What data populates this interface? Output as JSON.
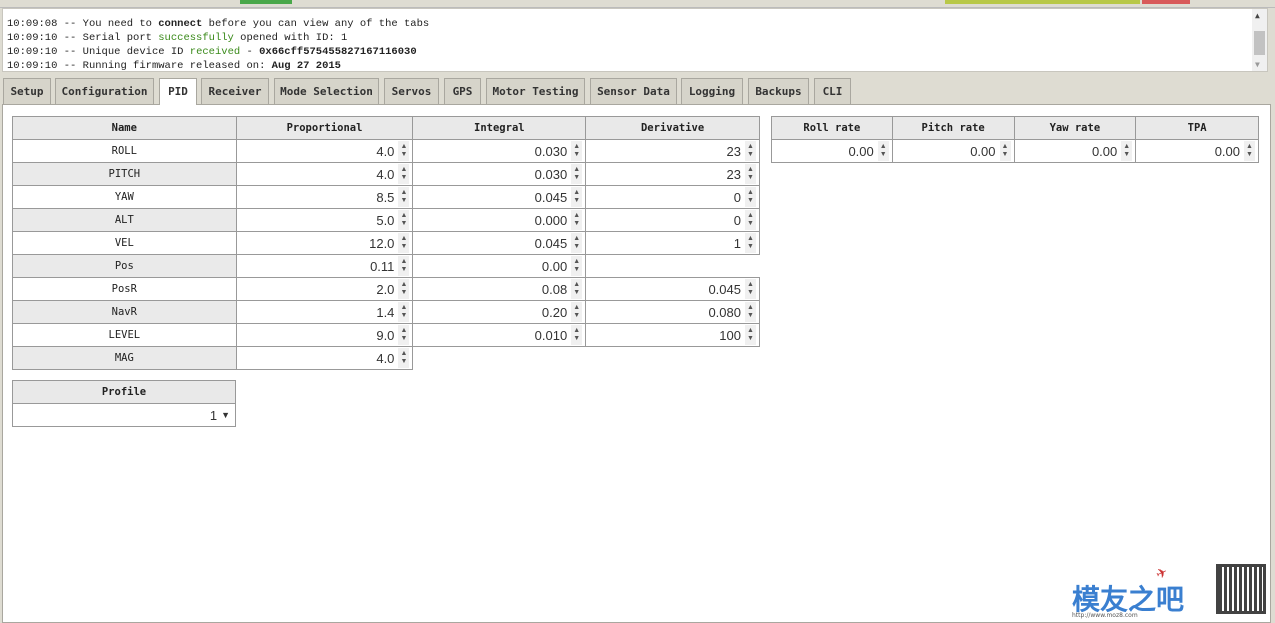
{
  "log": {
    "lines": [
      {
        "time": "10:09:08",
        "parts": [
          {
            "t": "-- You need to "
          },
          {
            "t": "connect",
            "style": "bold"
          },
          {
            "t": " before you can view any of the tabs"
          }
        ]
      },
      {
        "time": "10:09:10",
        "parts": [
          {
            "t": "-- Serial port "
          },
          {
            "t": "successfully",
            "style": "green"
          },
          {
            "t": " opened with ID: 1"
          }
        ]
      },
      {
        "time": "10:09:10",
        "parts": [
          {
            "t": "-- Unique device ID "
          },
          {
            "t": "received",
            "style": "green"
          },
          {
            "t": " - "
          },
          {
            "t": "0x66cff575455827167116030",
            "style": "bold"
          }
        ]
      },
      {
        "time": "10:09:10",
        "parts": [
          {
            "t": "-- Running firmware released on: "
          },
          {
            "t": "Aug 27 2015",
            "style": "bold"
          }
        ]
      }
    ]
  },
  "tabs": [
    "Setup",
    "Configuration",
    "PID",
    "Receiver",
    "Mode Selection",
    "Servos",
    "GPS",
    "Motor Testing",
    "Sensor Data",
    "Logging",
    "Backups",
    "CLI"
  ],
  "active_tab": "PID",
  "pid": {
    "headers": [
      "Name",
      "Proportional",
      "Integral",
      "Derivative"
    ],
    "rows": [
      [
        "ROLL",
        "4.0",
        "0.030",
        "23"
      ],
      [
        "PITCH",
        "4.0",
        "0.030",
        "23"
      ],
      [
        "YAW",
        "8.5",
        "0.045",
        "0"
      ],
      [
        "ALT",
        "5.0",
        "0.000",
        "0"
      ],
      [
        "VEL",
        "12.0",
        "0.045",
        "1"
      ],
      [
        "Pos",
        "0.11",
        "0.00",
        null
      ],
      [
        "PosR",
        "2.0",
        "0.08",
        "0.045"
      ],
      [
        "NavR",
        "1.4",
        "0.20",
        "0.080"
      ],
      [
        "LEVEL",
        "9.0",
        "0.010",
        "100"
      ],
      [
        "MAG",
        "4.0",
        null,
        null
      ]
    ]
  },
  "rates": {
    "headers": [
      "Roll rate",
      "Pitch rate",
      "Yaw rate",
      "TPA"
    ],
    "values": [
      "0.00",
      "0.00",
      "0.00",
      "0.00"
    ]
  },
  "profile": {
    "header": "Profile",
    "value": "1"
  },
  "watermark": {
    "text": "模友之吧",
    "url": "http://www.moz8.com"
  },
  "colors": {
    "status_green": "#3a8a1a",
    "tab_active": "#ffffff",
    "tab_inactive": "#d6d4ca"
  }
}
